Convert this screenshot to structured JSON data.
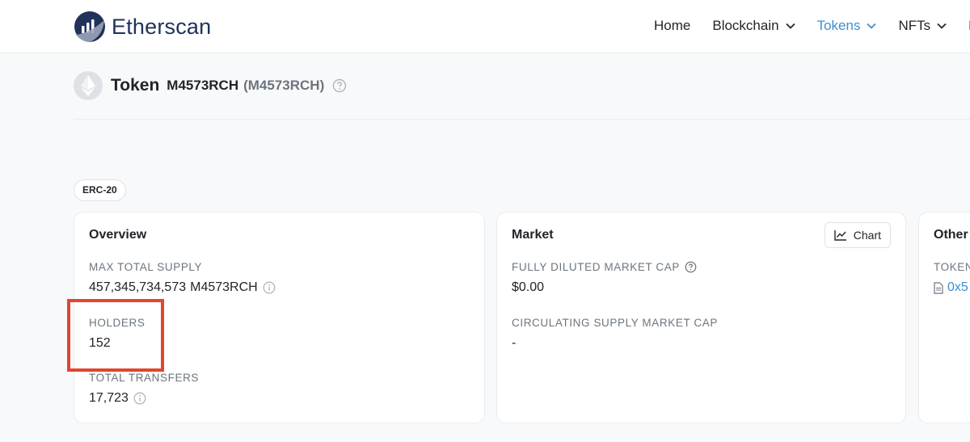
{
  "header": {
    "logo_text": "Etherscan",
    "nav": [
      {
        "label": "Home",
        "dropdown": false,
        "active": false
      },
      {
        "label": "Blockchain",
        "dropdown": true,
        "active": false
      },
      {
        "label": "Tokens",
        "dropdown": true,
        "active": true
      },
      {
        "label": "NFTs",
        "dropdown": true,
        "active": false
      },
      {
        "label": "R",
        "dropdown": false,
        "active": false
      }
    ]
  },
  "token": {
    "heading": "Token",
    "name": "M4573RCH",
    "symbol": "(M4573RCH)",
    "standard": "ERC-20"
  },
  "overview": {
    "title": "Overview",
    "max_supply_label": "MAX TOTAL SUPPLY",
    "max_supply_value": "457,345,734,573",
    "max_supply_unit": "M4573RCH",
    "holders_label": "HOLDERS",
    "holders_value": "152",
    "transfers_label": "TOTAL TRANSFERS",
    "transfers_value": "17,723"
  },
  "market": {
    "title": "Market",
    "chart_button": "Chart",
    "fdmc_label": "FULLY DILUTED MARKET CAP",
    "fdmc_value": "$0.00",
    "csmc_label": "CIRCULATING SUPPLY MARKET CAP",
    "csmc_value": "-"
  },
  "other": {
    "title": "Other",
    "contract_label": "TOKEN",
    "contract_value": "0x5"
  },
  "colors": {
    "accent": "#3d8fd1",
    "brand": "#21325b",
    "highlight": "#e2462d"
  }
}
